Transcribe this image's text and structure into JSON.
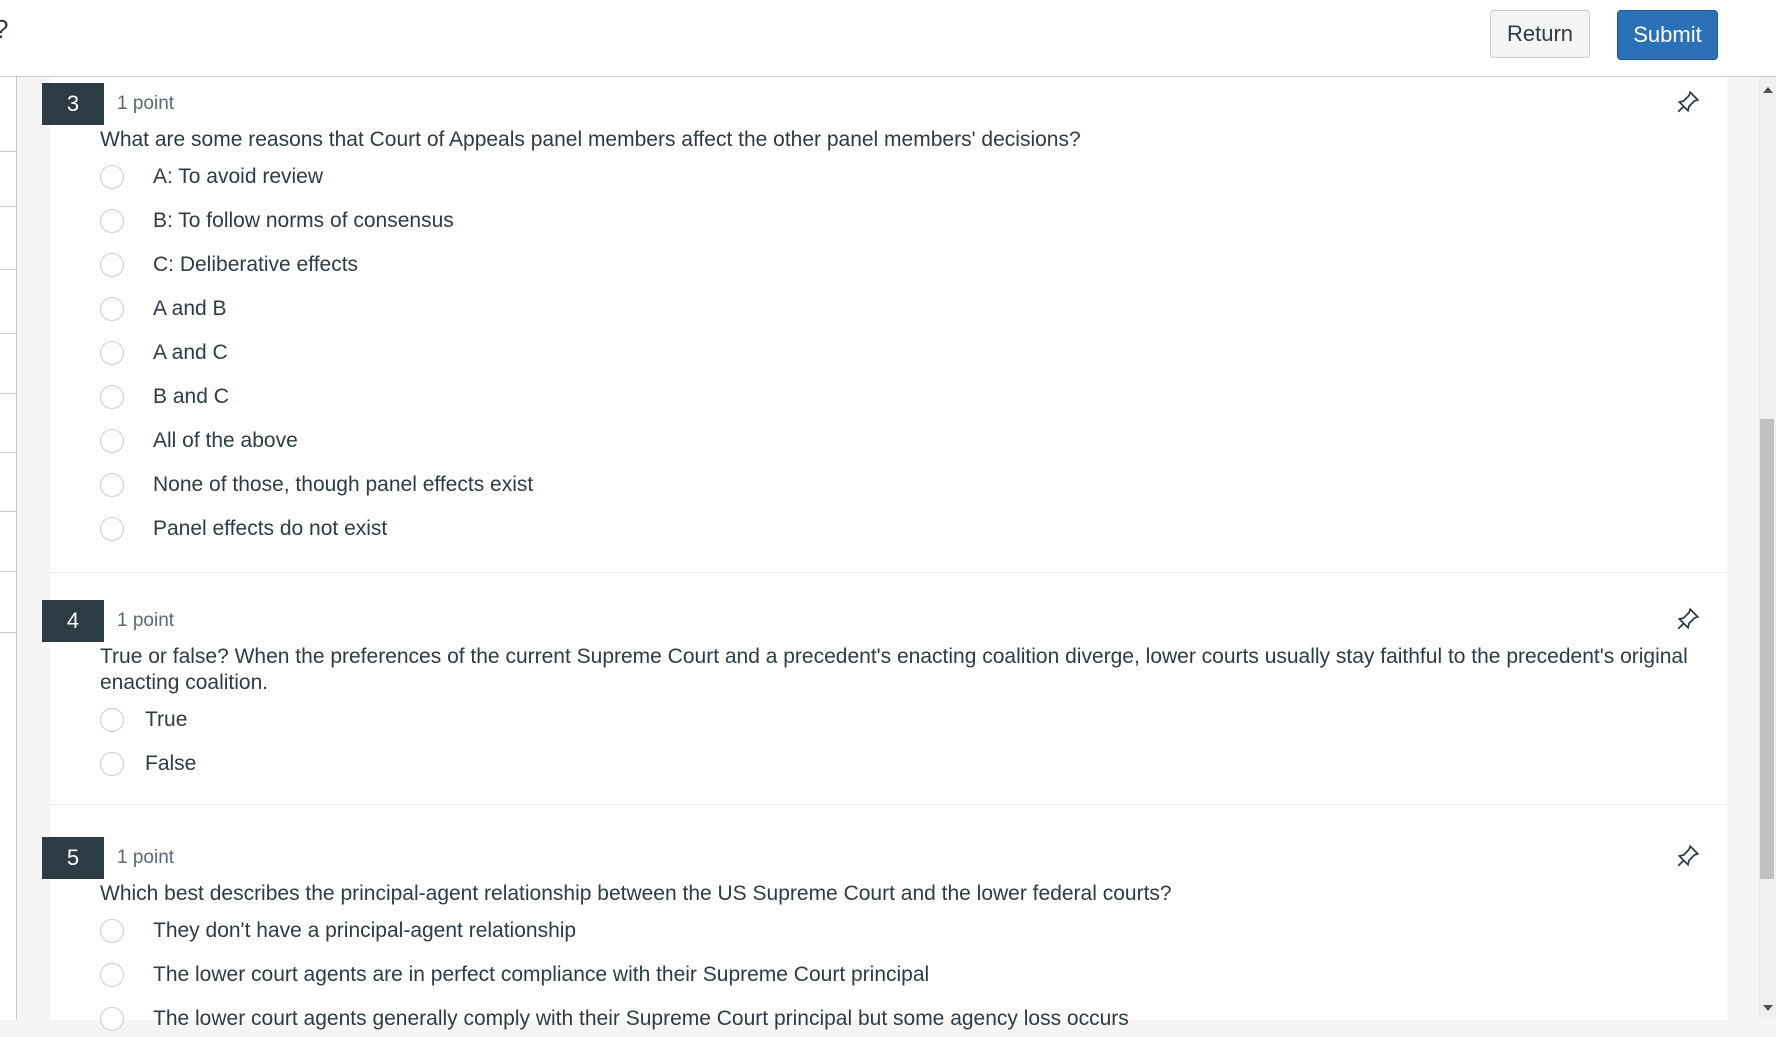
{
  "header": {
    "return_label": "Return",
    "submit_label": "Submit"
  },
  "questions": [
    {
      "number": "3",
      "points": "1 point",
      "text": "What are some reasons that Court of Appeals panel members affect the other panel members' decisions?",
      "options": [
        "A: To avoid review",
        "B: To follow norms of consensus",
        "C: Deliberative effects",
        "A and B",
        "A and C",
        "B and C",
        "All of the above",
        "None of those, though panel effects exist",
        "Panel effects do not exist"
      ]
    },
    {
      "number": "4",
      "points": "1 point",
      "text": "True or false? When the preferences of the current Supreme Court and a precedent's enacting coalition diverge, lower courts usually stay faithful to the precedent's original enacting coalition.",
      "options": [
        "True",
        "False"
      ]
    },
    {
      "number": "5",
      "points": "1 point",
      "text": "Which best describes the principal-agent relationship between the US Supreme Court and the lower federal courts?",
      "options": [
        "They don't have a principal-agent relationship",
        "The lower court agents are in perfect compliance with their Supreme Court principal",
        "The lower court agents generally comply with their Supreme Court principal but some agency loss occurs"
      ]
    }
  ],
  "icons": {
    "pin": "pin-icon",
    "scroll_up": "arrow-up-icon",
    "scroll_down": "arrow-down-icon"
  },
  "colors": {
    "submit_bg": "#2b71b8",
    "question_badge_bg": "#2d3b45",
    "text": "#2d3b45"
  }
}
